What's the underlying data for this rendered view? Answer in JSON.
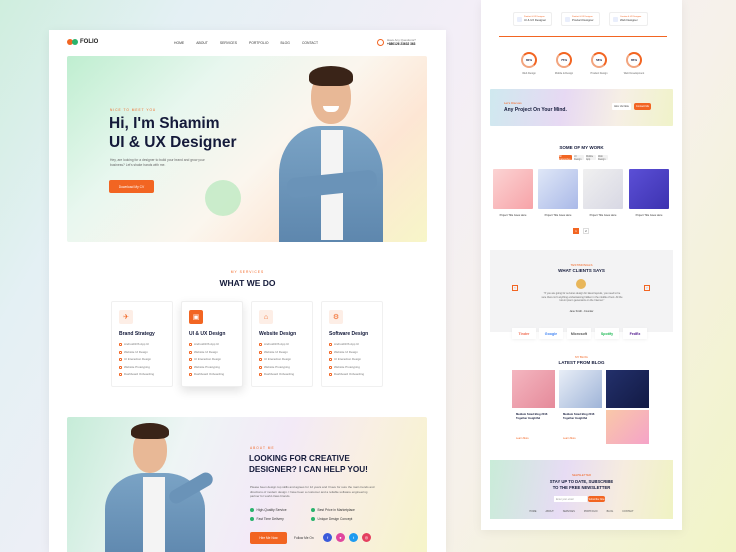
{
  "brand": {
    "logo": "FOLIO"
  },
  "nav": {
    "items": [
      "HOME",
      "ABOUT",
      "SERVICES",
      "PORTFOLIO",
      "BLOG",
      "CONTACT"
    ],
    "call_label": "Have Any Questions?",
    "call_number": "+880126 23632 363"
  },
  "hero": {
    "kicker": "NICE TO MEET YOU",
    "title_line1": "Hi, I'm Shamim",
    "title_line2": "UI & UX Designer",
    "desc": "Hey, are looking for a designer to build your brand and grow your business? Let's shake hands with me.",
    "cta": "Download My CV"
  },
  "services": {
    "kicker": "MY SERVICES",
    "title": "WHAT WE DO",
    "cards": [
      {
        "icon": "rocket-icon",
        "glyph": "✈",
        "title": "Brand Strategy",
        "items": [
          "Android/iOS App UI",
          "Website UI Design",
          "UI Interaction Design",
          "Website Prototyping",
          "Dashboard Onboarding"
        ]
      },
      {
        "icon": "ui-design-icon",
        "glyph": "▣",
        "title": "UI & UX Design",
        "items": [
          "Android/iOS App UI",
          "Website UI Design",
          "UI Interaction Design",
          "Website Prototyping",
          "Dashboard Onboarding"
        ]
      },
      {
        "icon": "web-design-icon",
        "glyph": "⌂",
        "title": "Website Design",
        "items": [
          "Android/iOS App UI",
          "Website UI Design",
          "UI Interaction Design",
          "Website Prototyping",
          "Dashboard Onboarding"
        ]
      },
      {
        "icon": "software-icon",
        "glyph": "⚙",
        "title": "Software Design",
        "items": [
          "Android/iOS App UI",
          "Website UI Design",
          "UI Interaction Design",
          "Website Prototyping",
          "Dashboard Onboarding"
        ]
      }
    ]
  },
  "about": {
    "kicker": "ABOUT ME",
    "title": "LOOKING FOR CREATIVE DESIGNER? I CAN HELP YOU!",
    "desc": "Please been design top skills and agrees for 12 years and I have for sure the main trends and directions of modern design. I have been a customer and a reliable software engineering partner for world class brands.",
    "features": [
      "High-Quality Service",
      "Best Price in Marketplace",
      "Fast Time Delivery",
      "Unique Design Concept"
    ],
    "cta": "Hire Me Now",
    "follow": "Follow Me On"
  },
  "right": {
    "skills": [
      {
        "top": "Product & UX Designer",
        "label": "UI & UX Designer"
      },
      {
        "top": "Product & UX Designer",
        "label": "Product Designer"
      },
      {
        "top": "Creative & UX Designer",
        "label": "Web Designer"
      }
    ],
    "rings": [
      {
        "value": "80%",
        "label": "Web Design"
      },
      {
        "value": "75%",
        "label": "Mobile & Design"
      },
      {
        "value": "58%",
        "label": "Product Design"
      },
      {
        "value": "85%",
        "label": "Web Development"
      }
    ],
    "cta": {
      "kicker": "Let's Discuss",
      "title": "Any Project On Your Mind.",
      "btn1": "Hire Us Now",
      "btn2": "Contact Me"
    },
    "work": {
      "title": "SOME OF MY WORK",
      "tabs": [
        "All Categories",
        "UI Design",
        "Mobile App",
        "Web Design"
      ],
      "projects": [
        "Project Title Goes Here",
        "Project Title Goes Here",
        "Project Title Goes Here",
        "Project Title Goes Here"
      ],
      "pages": [
        "1",
        "2"
      ]
    },
    "clients": {
      "kicker": "TESTIMONIALS",
      "title": "WHAT CLIENTS SAYS",
      "quote": "\"If you are going for services design for latest layouts, you need to be sure there isn't anything embarrassing hidden in the middle of text. All the lorem ipsum generators on the Internet.\"",
      "name": "Jane Smith - Founder",
      "brands": [
        "Tinder",
        "Google",
        "Microsoft",
        "Spotify",
        "FedEx"
      ]
    },
    "blog": {
      "kicker": "MY BLOG",
      "title": "LATEST FROM BLOG",
      "posts": [
        "Medium Sized Blog 2016 Together Insightful",
        "Medium Sized Blog 2016 Together Insightful",
        "Medium Sized Blog 2016 Together Insightful"
      ],
      "more": "Learn More"
    },
    "newsletter": {
      "kicker": "NEWSLETTER",
      "line1": "STAY UP TO DATE, SUBSCRIBE",
      "line2": "TO THE FREE NEWSLETTER",
      "placeholder": "Enter your email",
      "btn": "Subscribe Now"
    },
    "footer_nav": [
      "HOME",
      "ABOUT",
      "SERVICES",
      "PORTFOLIO",
      "BLOG",
      "CONTACT"
    ]
  },
  "colors": {
    "accent": "#f26522",
    "navy": "#141a3a",
    "check": "#29b36c"
  }
}
